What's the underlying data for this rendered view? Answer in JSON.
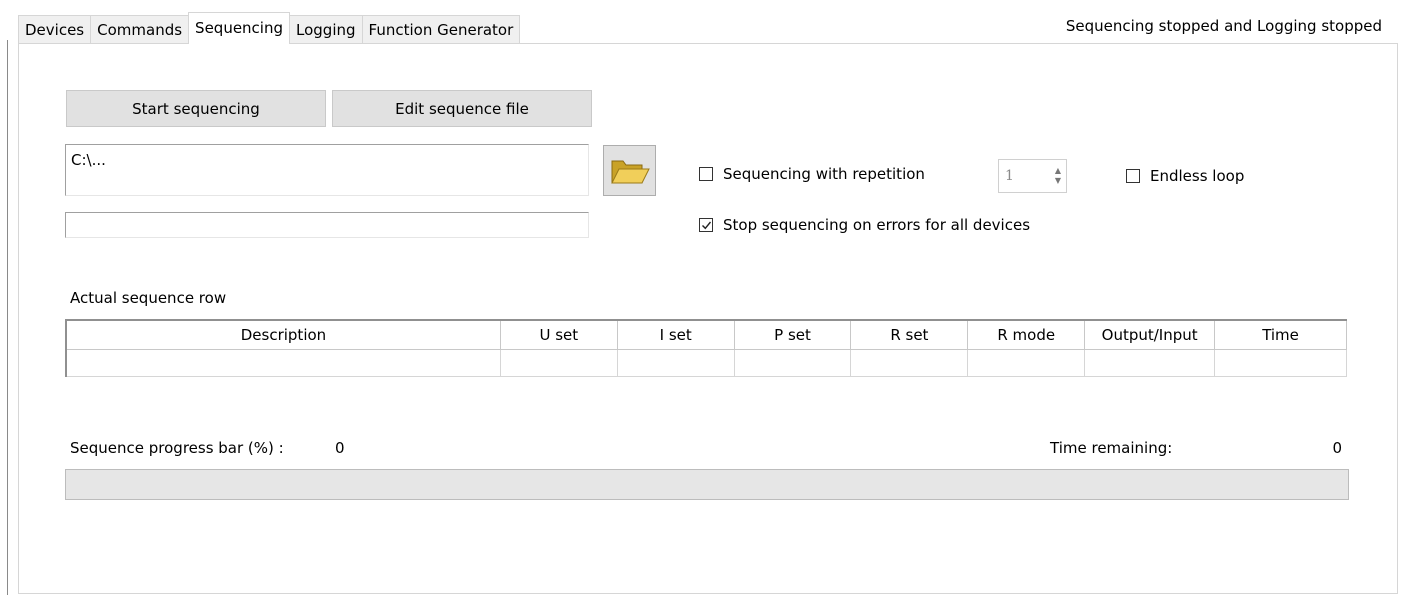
{
  "tabs": [
    {
      "label": "Devices",
      "active": false
    },
    {
      "label": "Commands",
      "active": false
    },
    {
      "label": "Sequencing",
      "active": true
    },
    {
      "label": "Logging",
      "active": false
    },
    {
      "label": "Function Generator",
      "active": false
    }
  ],
  "status": "Sequencing stopped and Logging stopped",
  "buttons": {
    "start": "Start sequencing",
    "edit": "Edit sequence file"
  },
  "file_path": "C:\\...",
  "file_info": "",
  "options": {
    "repetition_label": "Sequencing with repetition",
    "repetition_checked": false,
    "repetition_count": "1",
    "endless_label": "Endless loop",
    "endless_checked": false,
    "stop_on_errors_label": "Stop sequencing on errors for all devices",
    "stop_on_errors_checked": true
  },
  "sequence_row": {
    "title": "Actual sequence row",
    "columns": [
      "Description",
      "U set",
      "I set",
      "P set",
      "R set",
      "R mode",
      "Output/Input",
      "Time"
    ],
    "values": [
      "",
      "",
      "",
      "",
      "",
      "",
      "",
      ""
    ]
  },
  "progress": {
    "label": "Sequence progress bar (%) :",
    "value": "0",
    "fraction": 0,
    "time_label": "Time remaining:",
    "time_value": "0"
  },
  "colors": {
    "tab_border": "#d6d6d6",
    "button_bg": "#e1e1e1",
    "progress_bg": "#e6e6e6"
  }
}
